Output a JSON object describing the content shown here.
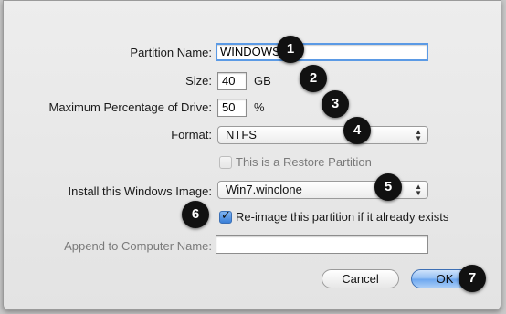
{
  "form": {
    "partition_name": {
      "label": "Partition Name:",
      "value": "WINDOWS"
    },
    "size": {
      "label": "Size:",
      "value": "40",
      "unit": "GB"
    },
    "max_percent": {
      "label": "Maximum Percentage of Drive:",
      "value": "50",
      "unit": "%"
    },
    "format": {
      "label": "Format:",
      "selected": "NTFS"
    },
    "restore_partition": {
      "label": "This is a Restore Partition",
      "checked": false,
      "enabled": false
    },
    "windows_image": {
      "label": "Install this Windows Image:",
      "selected": "Win7.winclone"
    },
    "reimage": {
      "label": "Re-image this partition if it already exists",
      "checked": true
    },
    "append_name": {
      "label": "Append to Computer Name:",
      "value": ""
    }
  },
  "buttons": {
    "cancel": "Cancel",
    "ok": "OK"
  },
  "callouts": [
    "1",
    "2",
    "3",
    "4",
    "5",
    "6",
    "7"
  ],
  "colors": {
    "focus_ring": "#5b9ae5",
    "default_button": "#6aa5ef",
    "callout": "#111111"
  },
  "icons": {
    "popup_arrows": "up-down-arrows-icon",
    "checkmark": "checkmark-icon"
  }
}
